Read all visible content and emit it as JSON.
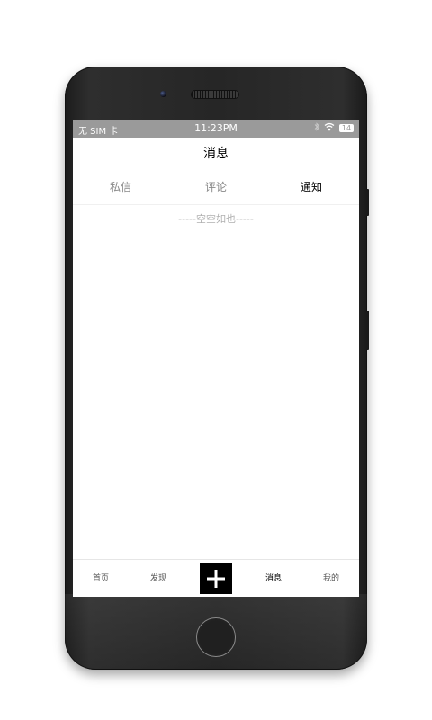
{
  "status_bar": {
    "carrier": "无 SIM 卡",
    "time": "11:23PM",
    "battery": "14",
    "icons": [
      "bluetooth-icon",
      "wifi-icon",
      "battery-icon"
    ]
  },
  "nav": {
    "title": "消息"
  },
  "tabs": [
    {
      "label": "私信",
      "active": false
    },
    {
      "label": "评论",
      "active": false
    },
    {
      "label": "通知",
      "active": true
    }
  ],
  "content": {
    "empty_text": "-----空空如也-----"
  },
  "bottom_nav": {
    "items": [
      {
        "label": "首页",
        "active": false
      },
      {
        "label": "发现",
        "active": false
      },
      {
        "label": "消息",
        "active": true
      },
      {
        "label": "我的",
        "active": false
      }
    ],
    "center_icon": "plus-icon"
  },
  "colors": {
    "status_bar_bg": "#9a9a9a",
    "active_tab": "#000000",
    "inactive_tab": "#888888",
    "plus_button_bg": "#000000"
  }
}
